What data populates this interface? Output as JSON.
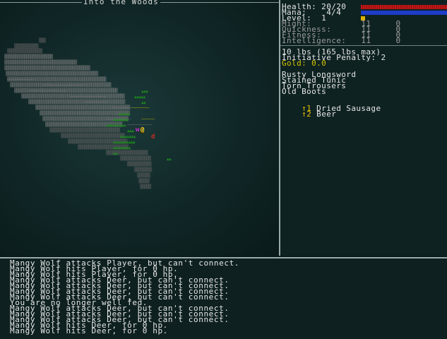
{
  "map": {
    "title": "Into the Woods",
    "player_glyph": "@",
    "deer_glyph": "d",
    "wolf_glyph": "w"
  },
  "stats": {
    "health": "Health: 20/20",
    "mana": "Mana:    4/4",
    "level": "Level:  1",
    "might": "Might:          11     0",
    "quickness": "Quickness:      11     0",
    "fitness": "Fitness:        11     0",
    "intelligence": "Intelligence:   11     0",
    "weight": "10 lbs (165 lbs max)",
    "initiative": "Initiative Penalty: 2",
    "gold": "Gold: 0.0"
  },
  "equipment": [
    "Rusty Longsword",
    "Stained Tunic",
    "Torn Trousers",
    "Old Boots"
  ],
  "consumables": [
    {
      "key": "↑1",
      "label": "Dried Sausage"
    },
    {
      "key": "↑2",
      "label": "Beer"
    }
  ],
  "colors": {
    "health_bar": "#c21818",
    "mana_bar": "#1e3cc8",
    "xp_bar": "#d8b000",
    "gold": "#d4c400",
    "item_key": "#e8c000"
  },
  "log": [
    "Mangy Wolf attacks Player, but can't connect.",
    "Mangy Wolf hits Player, for 0 hp.",
    "Mangy Wolf hits Player, for 0 hp.",
    "Mangy Wolf attacks Deer, but can't connect.",
    "Mangy Wolf attacks Deer, but can't connect.",
    "Mangy Wolf attacks Deer, but can't connect.",
    "Mangy Wolf attacks Deer, but can't connect.",
    "You are no longer well fed.",
    "Mangy Wolf attacks Deer, but can't connect.",
    "Mangy Wolf attacks Deer, but can't connect.",
    "Mangy Wolf attacks Deer, but can't connect.",
    "Mangy Wolf hits Deer, for 0 hp.",
    "Mangy Wolf hits Deer, for 0 hp."
  ]
}
